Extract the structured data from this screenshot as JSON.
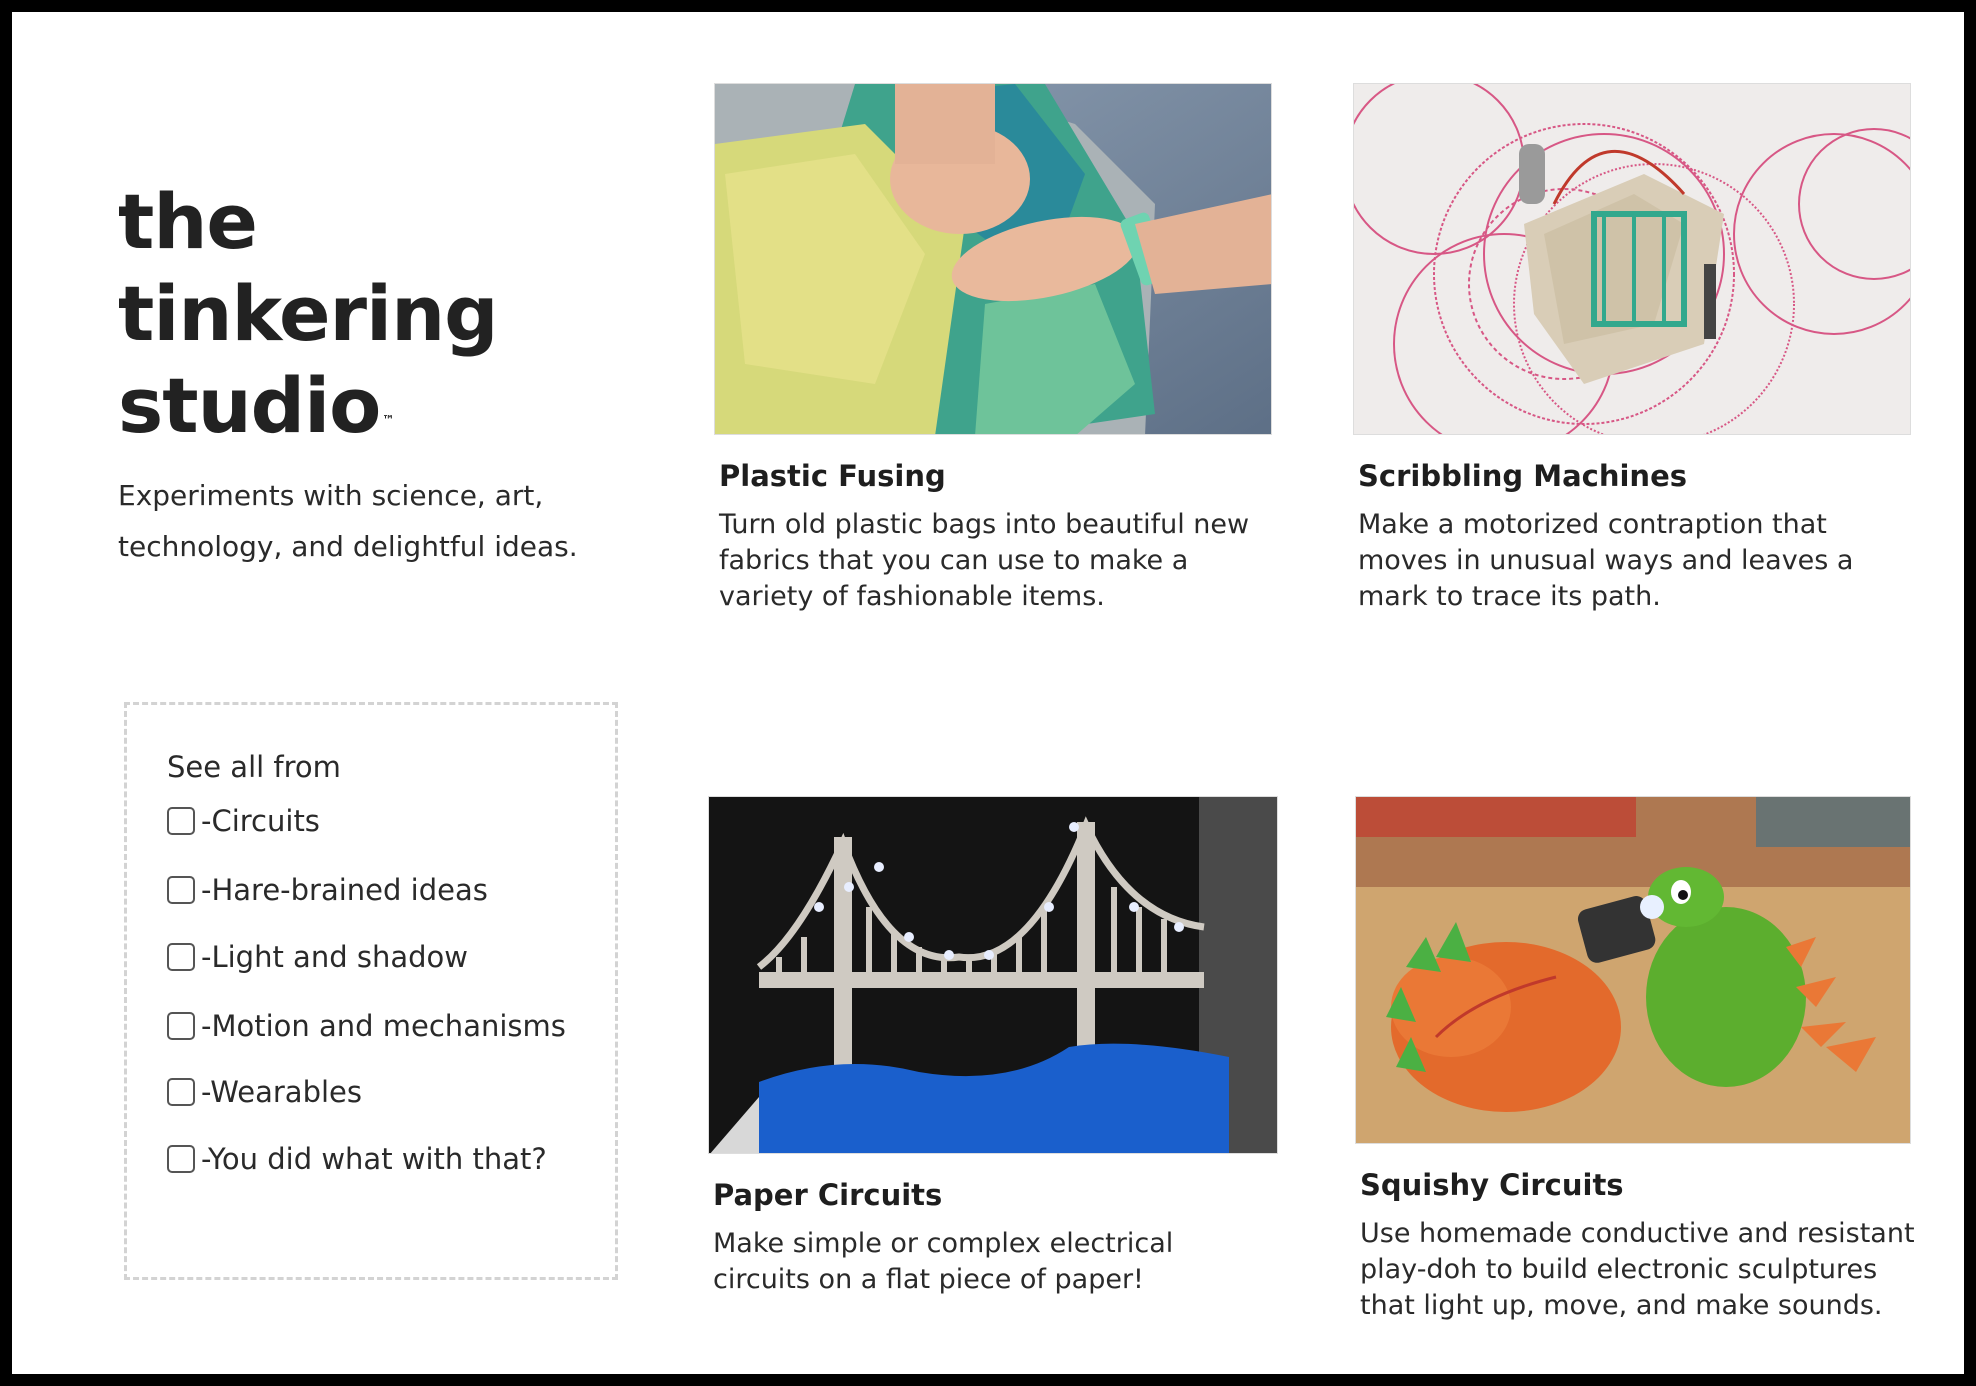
{
  "brand": {
    "logo_line1": "the",
    "logo_line2": "tinkering",
    "logo_line3": "studio",
    "logo_mark": "™",
    "tagline": "Experiments with science, art, technology, and delightful ideas."
  },
  "filters": {
    "heading": "See all from",
    "items": [
      {
        "label": "-Circuits",
        "checked": false
      },
      {
        "label": "-Hare-brained ideas",
        "checked": false
      },
      {
        "label": "-Light and shadow",
        "checked": false
      },
      {
        "label": "-Motion and mechanisms",
        "checked": false
      },
      {
        "label": "-Wearables",
        "checked": false
      },
      {
        "label": "-You did what with that?",
        "checked": false
      }
    ]
  },
  "cards": [
    {
      "title": "Plastic Fusing",
      "description": "Turn old plastic bags into beautiful new fabrics that you can use to make a variety of fashionable items.",
      "image_icon": "plastic-fusing-photo"
    },
    {
      "title": "Scribbling Machines",
      "description": "Make a motorized contraption that moves in unusual ways and leaves a mark to trace its path.",
      "image_icon": "scribbling-machines-photo"
    },
    {
      "title": "Paper Circuits",
      "description": "Make simple or complex electrical circuits on a flat piece of paper!",
      "image_icon": "paper-circuits-photo"
    },
    {
      "title": "Squishy Circuits",
      "description": "Use homemade conductive and resistant play-doh to build electronic sculptures that light up, move, and make sounds.",
      "image_icon": "squishy-circuits-photo"
    }
  ]
}
